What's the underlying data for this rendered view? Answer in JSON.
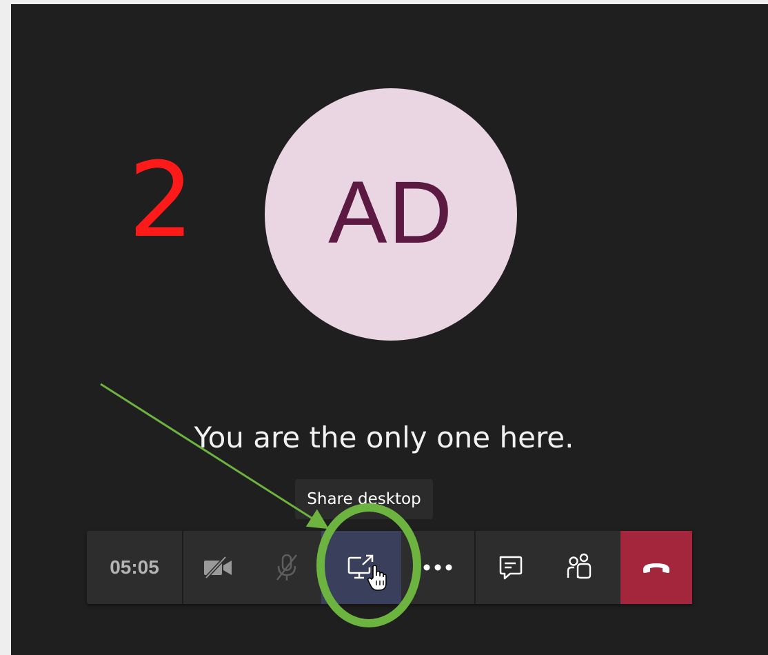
{
  "annotation": {
    "step_number": "2",
    "step_color": "#ff1a1a",
    "circle_color": "#6db33f",
    "arrow_color": "#6db33f"
  },
  "participant": {
    "initials": "AD",
    "avatar_bg": "#ead5e3",
    "initials_color": "#5c1a43"
  },
  "status": {
    "message": "You are the only one here."
  },
  "tooltip": {
    "text": "Share desktop"
  },
  "call_bar": {
    "timer": "05:05",
    "buttons": [
      {
        "name": "camera-off",
        "icon": "video-off-icon"
      },
      {
        "name": "mic-off",
        "icon": "mic-off-icon"
      },
      {
        "name": "share-desktop",
        "icon": "share-screen-icon"
      },
      {
        "name": "more-options",
        "icon": "ellipsis-icon"
      },
      {
        "name": "chat",
        "icon": "chat-icon"
      },
      {
        "name": "participants",
        "icon": "people-icon"
      },
      {
        "name": "hang-up",
        "icon": "phone-hangup-icon"
      }
    ],
    "hangup_color": "#a4263c"
  }
}
